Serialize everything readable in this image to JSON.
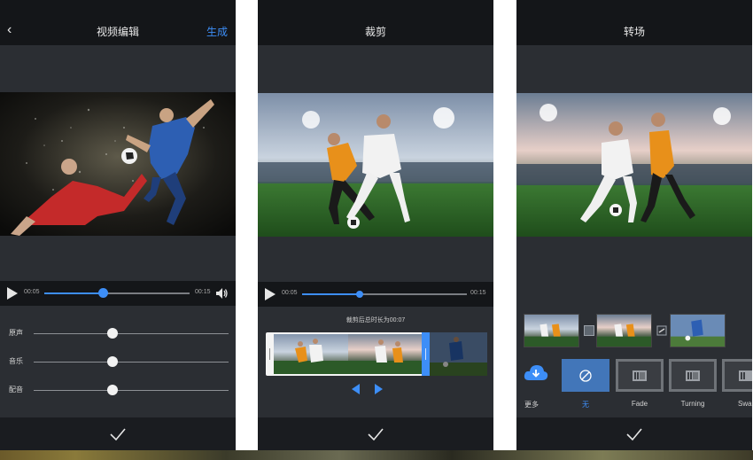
{
  "colors": {
    "accent": "#3d8ef7",
    "bar": "#141619",
    "panel": "#2b2e33"
  },
  "screen1": {
    "title": "视频编辑",
    "action": "生成",
    "back_icon": "chevron-left-icon",
    "player": {
      "current": "00:05",
      "total": "00:15",
      "progress": 0.4
    },
    "mix": [
      {
        "label": "原声",
        "level": 0.4
      },
      {
        "label": "音乐",
        "level": 0.4
      },
      {
        "label": "配音",
        "level": 0.4
      }
    ]
  },
  "screen2": {
    "title": "裁剪",
    "player": {
      "current": "00:05",
      "total": "00:15",
      "progress": 0.35
    },
    "hint": "裁剪后总时长为00:07"
  },
  "screen3": {
    "title": "转场",
    "more_label": "更多",
    "transitions": [
      {
        "label": "无",
        "icon": "no-symbol-icon",
        "selected": true
      },
      {
        "label": "Fade",
        "icon": "film-strip-icon",
        "selected": false
      },
      {
        "label": "Turning",
        "icon": "film-strip-icon",
        "selected": false
      },
      {
        "label": "Swa",
        "icon": "film-strip-icon",
        "selected": false
      }
    ]
  }
}
